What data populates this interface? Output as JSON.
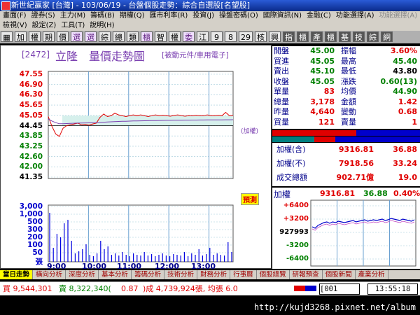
{
  "window": {
    "title": "新世紀贏家 [台灣] - 103/06/19 - 台盤個股走勢：綜合自選股[名望股]"
  },
  "menu1": [
    "畫面(F)",
    "證券(S)",
    "主力(M)",
    "籌碼(B)",
    "期權(Q)",
    "匯市利率(R)",
    "投資(J)",
    "操盤密碼(O)",
    "國際資訊(N)",
    "金融(C)",
    "功能選擇(A)",
    "功能選擇(A)"
  ],
  "menu2": [
    "檢視(V)",
    "設定(Z)",
    "工具(T)",
    "說明(H)"
  ],
  "toolbar": [
    "▦",
    "加",
    "權",
    "期",
    "價",
    "選",
    "選",
    "綜",
    "總",
    "類",
    "櫃",
    "智",
    "權",
    "委",
    "江",
    "9",
    "8",
    "29",
    "核",
    "興",
    "指",
    "櫃",
    "產",
    "櫃",
    "基",
    "技",
    "綜",
    "網"
  ],
  "chart": {
    "stock_code": "[2472]",
    "stock_name": "立隆",
    "chart_title": "量價走勢圖",
    "sector": "[被動元件/車用電子]",
    "price_ticks": [
      "47.55",
      "46.90",
      "46.30",
      "45.65",
      "45.05",
      "44.45",
      "43.85",
      "43.25",
      "42.60",
      "42.00",
      "41.35"
    ],
    "volume_ticks": [
      "3,000",
      "1,000",
      "500",
      "300",
      "200",
      "100",
      "50",
      "張"
    ],
    "time_ticks": [
      "9:00",
      "10:00",
      "11:00",
      "12:00",
      "13:00"
    ],
    "ref_label": "(加權)",
    "predict_label": "預測",
    "colors": {
      "price": "#e00000",
      "avg": "#7a3fb0",
      "volume": "#0000e0",
      "up": "#e00000",
      "down": "#008000",
      "flat": "#000000",
      "blue": "#0000cc",
      "fill": "#d6f0ec"
    }
  },
  "quote": [
    {
      "k1": "開盤",
      "v1": "45.00",
      "k2": "振幅",
      "v2": "3.60%",
      "c1": "#008000",
      "c2": "#e00000"
    },
    {
      "k1": "買進",
      "v1": "45.05",
      "k2": "最高",
      "v2": "45.40",
      "c1": "#008000",
      "c2": "#008000"
    },
    {
      "k1": "賣出",
      "v1": "45.10",
      "k2": "最低",
      "v2": "43.80",
      "c1": "#008000",
      "c2": "#000000"
    },
    {
      "k1": "收盤",
      "v1": "45.05",
      "k2": "漲跌",
      "v2": "0.60(13)",
      "c1": "#008000",
      "c2": "#008000"
    },
    {
      "k1": "單量",
      "v1": "83",
      "k2": "均價",
      "v2": "44.90",
      "c1": "#e00000",
      "c2": "#008000"
    },
    {
      "k1": "總量",
      "v1": "3,178",
      "k2": "金額",
      "v2": "1.42",
      "c1": "#e00000",
      "c2": "#e00000"
    },
    {
      "k1": "昨量",
      "v1": "4,640",
      "k2": "變動",
      "v2": "0.68",
      "c1": "#e00000",
      "c2": "#e00000"
    },
    {
      "k1": "買量",
      "v1": "121",
      "k2": "賣量",
      "v2": "1",
      "c1": "#e00000",
      "c2": "#e00000"
    }
  ],
  "summary": [
    {
      "label": "加權(含)",
      "value": "9316.81",
      "extra": "36.88"
    },
    {
      "label": "加權(不)",
      "value": "7918.56",
      "extra": "33.24"
    },
    {
      "label": "成交總額",
      "value": "902.71億",
      "extra": "19.0"
    }
  ],
  "mini": {
    "label": "加權",
    "index": "9316.81",
    "change": "36.88",
    "pct": "0.40%",
    "ticks": [
      "+6400",
      "+3200",
      "927993",
      "-3200",
      "-6400"
    ]
  },
  "tabs": [
    "當日走勢",
    "橫向分析",
    "深度分析",
    "基本分析",
    "籌碼分析",
    "技術分析",
    "財務分析",
    "行事曆",
    "個股總覽",
    "研報預查",
    "個股新聞",
    "產業分析"
  ],
  "status": {
    "buy": "買 9,544,301",
    "sell": "賣 8,322,340(",
    "chg": "0.87",
    "vol": ")成 4,739,924張, 均張 6.0",
    "code": "001",
    "time": "13:55:18"
  },
  "footer": {
    "url": "http://kujd3268.pixnet.net/album"
  }
}
